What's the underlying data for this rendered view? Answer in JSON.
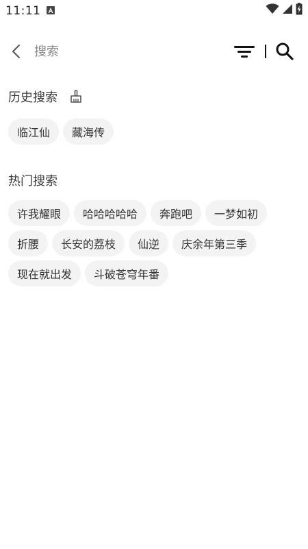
{
  "status_bar": {
    "time": "11:11",
    "icons": [
      "app-notification-icon",
      "wifi-icon",
      "cell-signal-icon",
      "battery-charging-icon"
    ]
  },
  "top_bar": {
    "back_icon": "chevron-left-icon",
    "search_placeholder": "搜索",
    "filter_icon": "filter-icon",
    "search_icon": "search-icon"
  },
  "history": {
    "title": "历史搜索",
    "clear_icon": "broom-icon",
    "items": [
      "临江仙",
      "藏海传"
    ]
  },
  "hot": {
    "title": "热门搜索",
    "rows": [
      [
        "许我耀眼",
        "哈哈哈哈哈",
        "奔跑吧",
        "一梦如初"
      ],
      [
        "折腰",
        "长安的荔枝",
        "仙逆",
        "庆余年第三季"
      ],
      [
        "现在就出发",
        "斗破苍穹年番"
      ]
    ]
  },
  "colors": {
    "chip_background": "#f3f3f3",
    "text": "#333333",
    "placeholder": "#8a8a8a"
  }
}
